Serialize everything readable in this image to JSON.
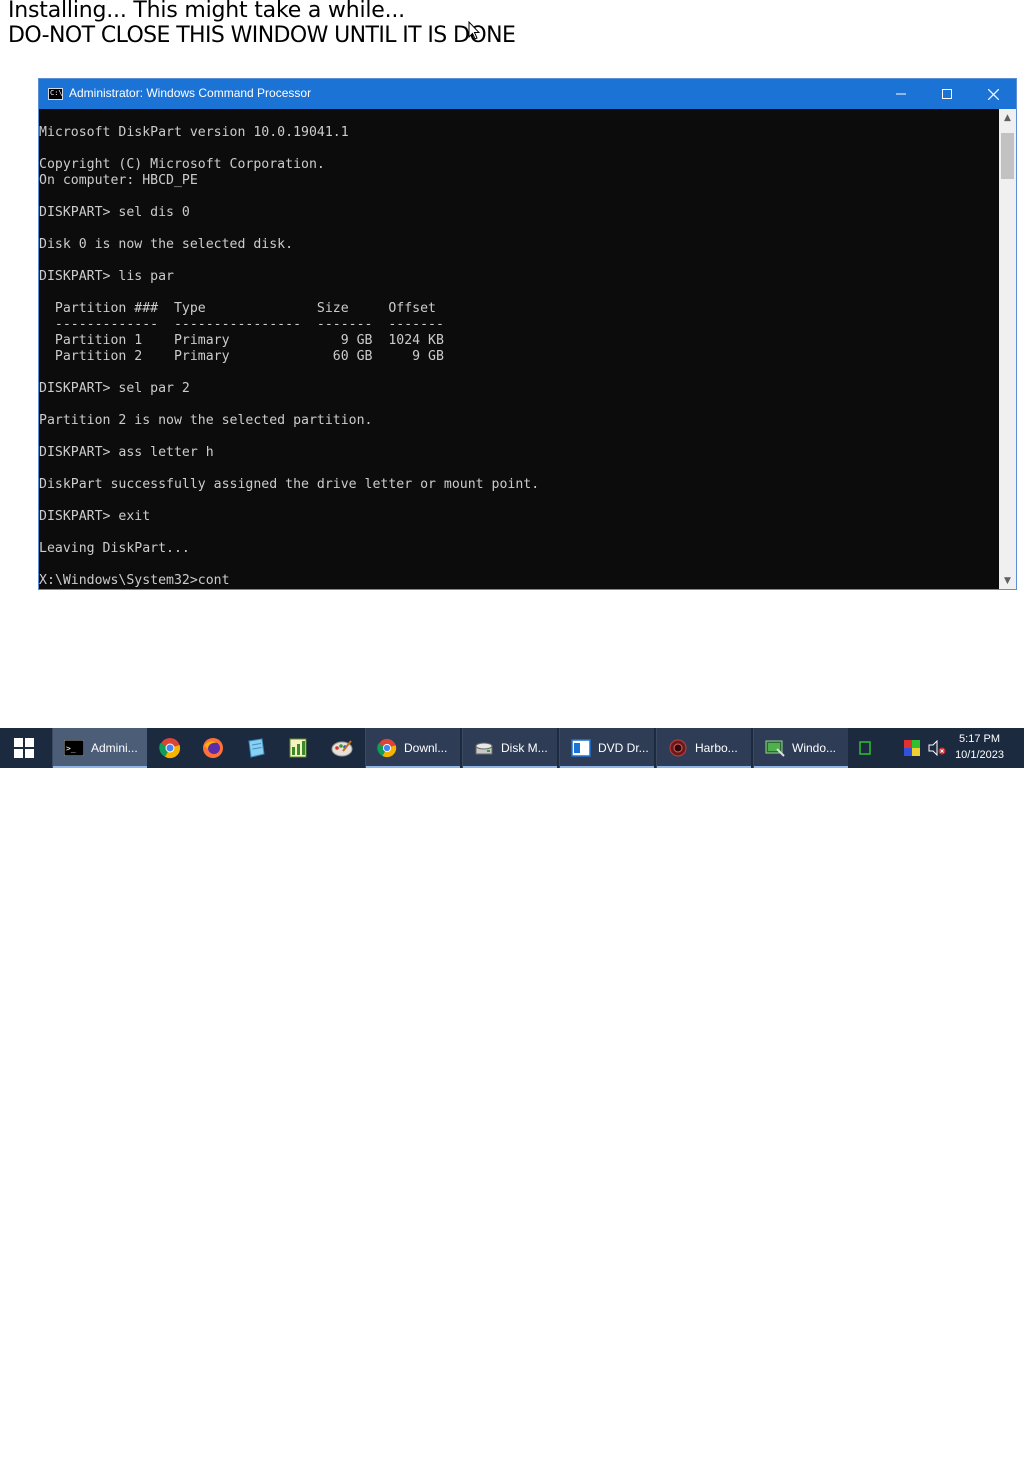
{
  "banner": {
    "line1": "Installing... This might take a while...",
    "line2": "DO-NOT CLOSE THIS WINDOW UNTIL IT IS DONE"
  },
  "window": {
    "title": "Administrator: Windows Command Processor",
    "icon_text": "C:\\",
    "minimize_glyph": "—",
    "maximize_glyph": "☐",
    "close_glyph": "✕"
  },
  "console": {
    "lines": [
      "Microsoft DiskPart version 10.0.19041.1",
      "",
      "Copyright (C) Microsoft Corporation.",
      "On computer: HBCD_PE",
      "",
      "DISKPART> sel dis 0",
      "",
      "Disk 0 is now the selected disk.",
      "",
      "DISKPART> lis par",
      "",
      "  Partition ###  Type              Size     Offset",
      "  -------------  ----------------  -------  -------",
      "  Partition 1    Primary              9 GB  1024 KB",
      "  Partition 2    Primary             60 GB     9 GB",
      "",
      "DISKPART> sel par 2",
      "",
      "Partition 2 is now the selected partition.",
      "",
      "DISKPART> ass letter h",
      "",
      "DiskPart successfully assigned the drive letter or mount point.",
      "",
      "DISKPART> exit",
      "",
      "Leaving DiskPart...",
      "",
      "X:\\Windows\\System32>cont"
    ]
  },
  "taskbar": {
    "items": [
      {
        "label": "Admini...",
        "icon": "cmd-icon"
      },
      {
        "label": "Downl...",
        "icon": "chrome-icon"
      },
      {
        "label": "Disk M...",
        "icon": "disk-management-icon"
      },
      {
        "label": "DVD Dr...",
        "icon": "explorer-icon"
      },
      {
        "label": "Harbo...",
        "icon": "harbor-icon"
      },
      {
        "label": "Windo...",
        "icon": "windows-app-icon"
      }
    ],
    "clock_time": "5:17 PM",
    "clock_date": "10/1/2023"
  },
  "colors": {
    "titlebar": "#1c73d6",
    "console_bg": "#0c0c0c",
    "console_text": "#cccccc",
    "taskbar": "#1b2a3f"
  }
}
